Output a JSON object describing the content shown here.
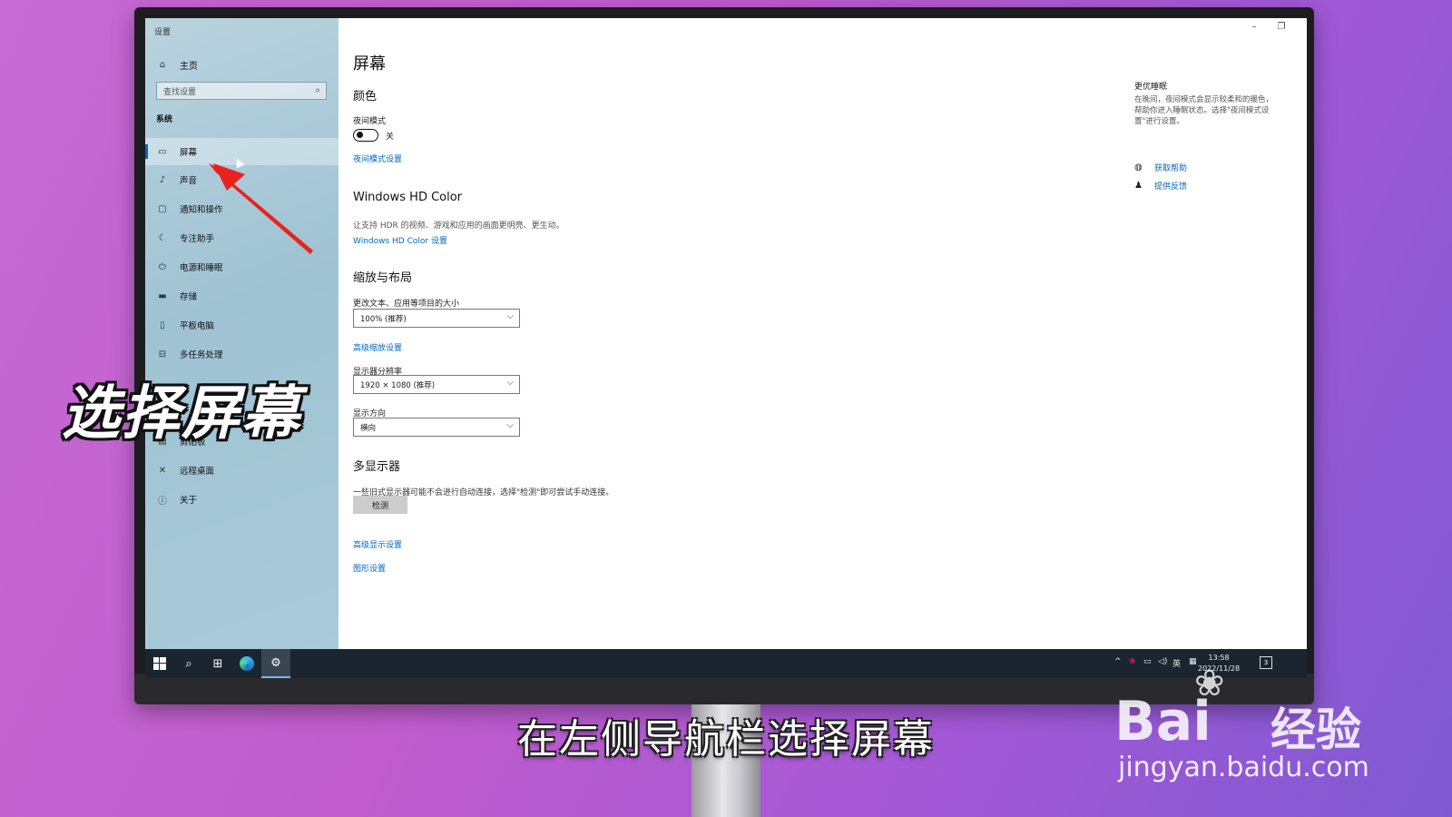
{
  "window": {
    "title": "设置"
  },
  "sidebar": {
    "home": "主页",
    "search_placeholder": "查找设置",
    "section": "系统",
    "items": [
      {
        "label": "屏幕",
        "icon": "monitor-icon"
      },
      {
        "label": "声音",
        "icon": "speaker-icon"
      },
      {
        "label": "通知和操作",
        "icon": "notification-icon"
      },
      {
        "label": "专注助手",
        "icon": "moon-icon"
      },
      {
        "label": "电源和睡眠",
        "icon": "power-icon"
      },
      {
        "label": "存储",
        "icon": "storage-icon"
      },
      {
        "label": "平板电脑",
        "icon": "tablet-icon"
      },
      {
        "label": "多任务处理",
        "icon": "multitask-icon"
      },
      {
        "label": "剪贴板",
        "icon": "clipboard-icon"
      },
      {
        "label": "远程桌面",
        "icon": "remote-icon"
      },
      {
        "label": "关于",
        "icon": "info-icon"
      }
    ]
  },
  "main": {
    "title": "屏幕",
    "color": {
      "heading": "颜色",
      "night_label": "夜间模式",
      "night_state": "关",
      "night_link": "夜间模式设置"
    },
    "hdr": {
      "heading": "Windows HD Color",
      "desc": "让支持 HDR 的视频、游戏和应用的画面更明亮、更生动。",
      "link": "Windows HD Color 设置"
    },
    "scale": {
      "heading": "缩放与布局",
      "size_label": "更改文本、应用等项目的大小",
      "size_value": "100% (推荐)",
      "adv_link": "高级缩放设置",
      "res_label": "显示器分辨率",
      "res_value": "1920 × 1080 (推荐)",
      "orient_label": "显示方向",
      "orient_value": "横向"
    },
    "multi": {
      "heading": "多显示器",
      "desc": "一些旧式显示器可能不会进行自动连接，选择\"检测\"即可尝试手动连接。",
      "detect_button": "检测",
      "adv_display_link": "高级显示设置",
      "graphics_link": "图形设置"
    }
  },
  "right_panel": {
    "title": "更优睡眠",
    "desc": "在晚间，夜间模式会显示较柔和的暖色，帮助你进入睡眠状态。选择\"夜间模式设置\"进行设置。",
    "help": "获取帮助",
    "feedback": "提供反馈"
  },
  "taskbar": {
    "ime": "英",
    "time": "13:58",
    "date": "2022/11/28",
    "notif_count": "3"
  },
  "overlay": {
    "caption": "选择屏幕",
    "subtitle": "在左侧导航栏选择屏幕",
    "watermark_logo": "Bai",
    "watermark_logo2": "经验",
    "watermark_url": "jingyan.baidu.com"
  },
  "colors": {
    "accent": "#0067c0",
    "arrow": "#e8231f"
  }
}
